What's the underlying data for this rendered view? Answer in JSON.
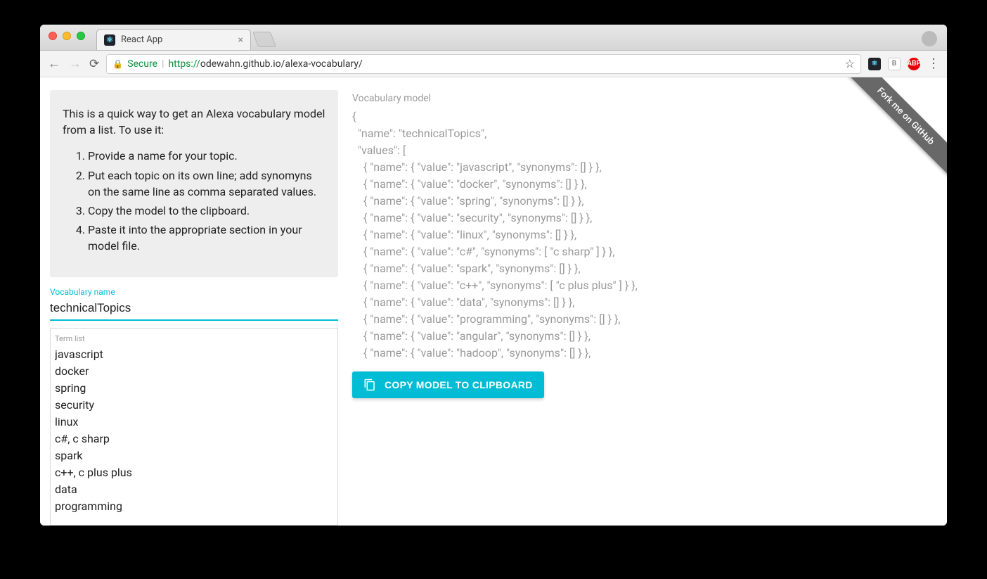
{
  "browser": {
    "tab_title": "React App",
    "secure_label": "Secure",
    "url_https": "https://",
    "url_host_path": "odewahn.github.io/alexa-vocabulary/"
  },
  "ribbon": {
    "label": "Fork me on GitHub"
  },
  "intro": {
    "text": "This is a quick way to get an Alexa vocabulary model from a list. To use it:",
    "steps": [
      "Provide a name for your topic.",
      "Put each topic on its own line; add synomyns on the same line as comma separated values.",
      "Copy the model to the clipboard.",
      "Paste it into the appropriate section in your model file."
    ]
  },
  "vocab_name": {
    "label": "Vocabulary name",
    "value": "technicalTopics"
  },
  "term_list": {
    "label": "Term list",
    "value": "javascript\ndocker\nspring\nsecurity\nlinux\nc#, c sharp\nspark\nc++, c plus plus\ndata\nprogramming"
  },
  "output": {
    "label": "Vocabulary model",
    "model_name": "technicalTopics",
    "entries": [
      {
        "value": "javascript",
        "synonyms": []
      },
      {
        "value": "docker",
        "synonyms": []
      },
      {
        "value": "spring",
        "synonyms": []
      },
      {
        "value": "security",
        "synonyms": []
      },
      {
        "value": "linux",
        "synonyms": []
      },
      {
        "value": "c#",
        "synonyms": [
          "c sharp"
        ]
      },
      {
        "value": "spark",
        "synonyms": []
      },
      {
        "value": "c++",
        "synonyms": [
          "c plus plus"
        ]
      },
      {
        "value": "data",
        "synonyms": []
      },
      {
        "value": "programming",
        "synonyms": []
      },
      {
        "value": "angular",
        "synonyms": []
      },
      {
        "value": "hadoop",
        "synonyms": []
      }
    ]
  },
  "copy_button": {
    "label": "COPY MODEL TO CLIPBOARD"
  }
}
